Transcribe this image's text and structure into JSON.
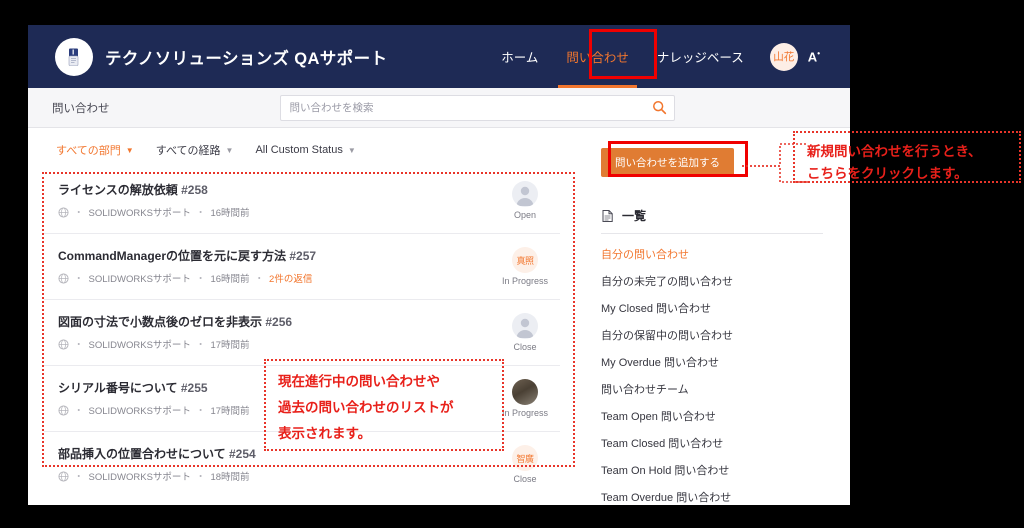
{
  "header": {
    "brand_title": "テクノソリューションズ QAサポート",
    "logo_icon": "book-logo-icon",
    "nav": [
      {
        "label": "ホーム",
        "active": false
      },
      {
        "label": "問い合わせ",
        "active": true
      },
      {
        "label": "ナレッジベース",
        "active": false
      }
    ],
    "avatar_initials": "山花",
    "language_label": "A",
    "accent_color": "#f2762e",
    "header_bg": "#1e2a55"
  },
  "subheader": {
    "breadcrumb": "問い合わせ",
    "search_placeholder": "問い合わせを検索",
    "search_value": "",
    "search_icon": "search-icon"
  },
  "filters": [
    {
      "label": "すべての部門",
      "active": true
    },
    {
      "label": "すべての経路",
      "active": false
    },
    {
      "label": "All Custom Status",
      "active": false
    }
  ],
  "tickets": [
    {
      "title": "ライセンスの解放依頼",
      "number": "#258",
      "channel_icon": "globe-icon",
      "department": "SOLIDWORKSサポート",
      "time": "16時間前",
      "replies": "",
      "status": "Open",
      "avatar_type": "generic",
      "avatar_text": ""
    },
    {
      "title": "CommandManagerの位置を元に戻す方法",
      "number": "#257",
      "channel_icon": "globe-icon",
      "department": "SOLIDWORKSサポート",
      "time": "16時間前",
      "replies": "2件の返信",
      "status": "In Progress",
      "avatar_type": "text",
      "avatar_text": "真照"
    },
    {
      "title": "図面の寸法で小数点後のゼロを非表示",
      "number": "#256",
      "channel_icon": "globe-icon",
      "department": "SOLIDWORKSサポート",
      "time": "17時間前",
      "replies": "",
      "status": "Close",
      "avatar_type": "generic",
      "avatar_text": ""
    },
    {
      "title": "シリアル番号について",
      "number": "#255",
      "channel_icon": "globe-icon",
      "department": "SOLIDWORKSサポート",
      "time": "17時間前",
      "replies": "",
      "status": "In Progress",
      "avatar_type": "photo",
      "avatar_text": ""
    },
    {
      "title": "部品挿入の位置合わせについて",
      "number": "#254",
      "channel_icon": "globe-icon",
      "department": "SOLIDWORKSサポート",
      "time": "18時間前",
      "replies": "",
      "status": "Close",
      "avatar_type": "text",
      "avatar_text": "智廣"
    }
  ],
  "side_panel": {
    "add_button_label": "問い合わせを追加する",
    "views_icon": "views-list-icon",
    "views_title": "一覧",
    "views": [
      {
        "label": "自分の問い合わせ",
        "active": true
      },
      {
        "label": "自分の未完了の問い合わせ",
        "active": false
      },
      {
        "label": "My Closed 問い合わせ",
        "active": false
      },
      {
        "label": "自分の保留中の問い合わせ",
        "active": false
      },
      {
        "label": "My Overdue 問い合わせ",
        "active": false
      },
      {
        "label": "問い合わせチーム",
        "active": false
      },
      {
        "label": "Team Open 問い合わせ",
        "active": false
      },
      {
        "label": "Team Closed 問い合わせ",
        "active": false
      },
      {
        "label": "Team On Hold 問い合わせ",
        "active": false
      },
      {
        "label": "Team Overdue 問い合わせ",
        "active": false
      }
    ]
  },
  "annotations": {
    "add_button_callout": "新規問い合わせを行うとき、\nこちらをクリックします。",
    "list_callout": "現在進行中の問い合わせや\n過去の問い合わせのリストが\n表示されます。",
    "annotation_color": "#e8201a"
  }
}
